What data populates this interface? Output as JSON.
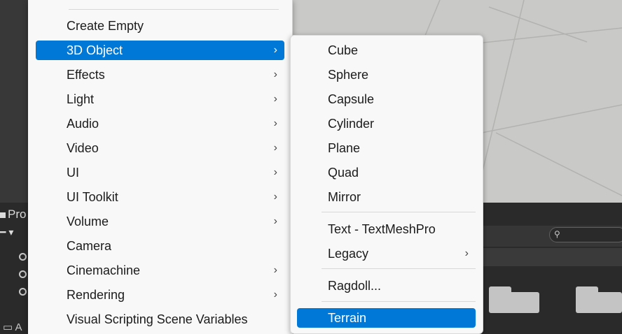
{
  "main_menu": {
    "items": [
      {
        "label": "Create Empty",
        "submenu": false
      },
      {
        "label": "3D Object",
        "submenu": true,
        "selected": true
      },
      {
        "label": "Effects",
        "submenu": true
      },
      {
        "label": "Light",
        "submenu": true
      },
      {
        "label": "Audio",
        "submenu": true
      },
      {
        "label": "Video",
        "submenu": true
      },
      {
        "label": "UI",
        "submenu": true
      },
      {
        "label": "UI Toolkit",
        "submenu": true
      },
      {
        "label": "Volume",
        "submenu": true
      },
      {
        "label": "Camera",
        "submenu": false
      },
      {
        "label": "Cinemachine",
        "submenu": true
      },
      {
        "label": "Rendering",
        "submenu": true
      },
      {
        "label": "Visual Scripting Scene Variables",
        "submenu": false
      }
    ],
    "chevron": "›"
  },
  "sub_menu": {
    "items": [
      {
        "label": "Cube"
      },
      {
        "label": "Sphere"
      },
      {
        "label": "Capsule"
      },
      {
        "label": "Cylinder"
      },
      {
        "label": "Plane"
      },
      {
        "label": "Quad"
      },
      {
        "label": "Mirror"
      },
      {
        "label": "Text - TextMeshPro"
      },
      {
        "label": "Legacy",
        "submenu": true
      },
      {
        "label": "Ragdoll..."
      },
      {
        "label": "Terrain",
        "selected": true
      }
    ]
  },
  "background": {
    "project_tab_label": "Pro",
    "folder_label": "A"
  },
  "colors": {
    "selection": "#0078d7",
    "menu_bg": "#f8f8f8",
    "scene_bg": "#c9c9c7",
    "editor_dark": "#2a2a2a"
  }
}
